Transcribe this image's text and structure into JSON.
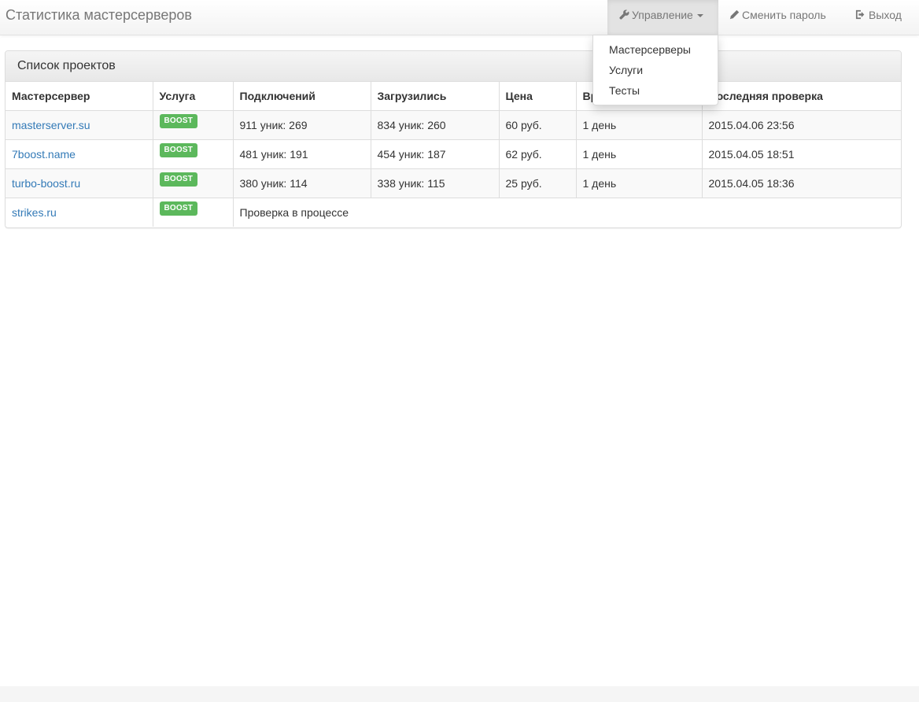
{
  "navbar": {
    "brand": "Статистика мастерсерверов",
    "management": {
      "label": "Управление",
      "icon": "wrench-icon"
    },
    "change_password": {
      "label": "Сменить пароль",
      "icon": "pencil-icon"
    },
    "logout": {
      "label": "Выход",
      "icon": "logout-icon"
    }
  },
  "dropdown": {
    "items": [
      "Мастерсерверы",
      "Услуги",
      "Тесты"
    ]
  },
  "panel": {
    "title": "Список проектов"
  },
  "table": {
    "headers": [
      "Мастерсервер",
      "Услуга",
      "Подключений",
      "Загрузились",
      "Цена",
      "Время",
      "Последняя проверка"
    ],
    "rows": [
      {
        "server": "masterserver.su",
        "service": "BOOST",
        "connections": "911 уник: 269",
        "loaded": "834 уник: 260",
        "price": "60 руб.",
        "time": "1 день",
        "last_check": "2015.04.06 23:56"
      },
      {
        "server": "7boost.name",
        "service": "BOOST",
        "connections": "481 уник: 191",
        "loaded": "454 уник: 187",
        "price": "62 руб.",
        "time": "1 день",
        "last_check": "2015.04.05 18:51"
      },
      {
        "server": "turbo-boost.ru",
        "service": "BOOST",
        "connections": "380 уник: 114",
        "loaded": "338 уник: 115",
        "price": "25 руб.",
        "time": "1 день",
        "last_check": "2015.04.05 18:36"
      },
      {
        "server": "strikes.ru",
        "service": "BOOST",
        "status": "Проверка в процессе"
      }
    ]
  },
  "colors": {
    "link": "#337ab7",
    "badge": "#5cb85c",
    "navbar_text": "#777777"
  }
}
